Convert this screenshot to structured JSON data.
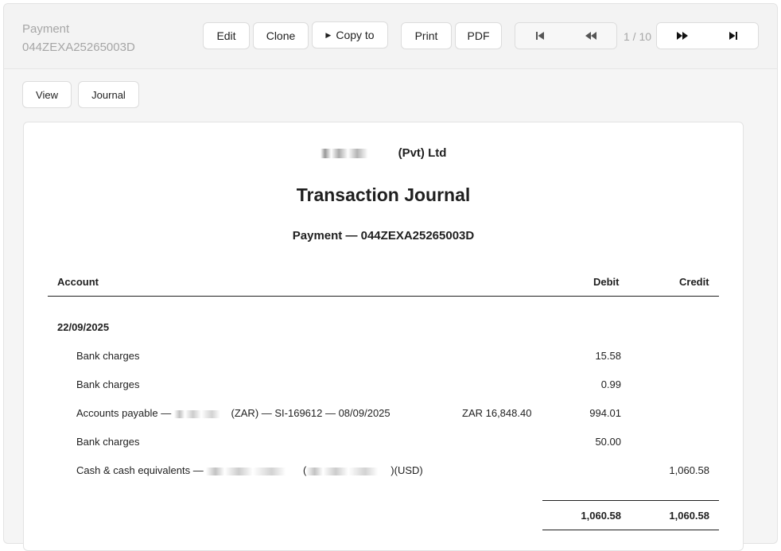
{
  "header": {
    "doc_type": "Payment",
    "doc_number": "044ZEXA25265003D",
    "edit_label": "Edit",
    "clone_label": "Clone",
    "copy_to_label": "Copy to",
    "print_label": "Print",
    "pdf_label": "PDF",
    "pager": "1 / 10"
  },
  "tabs": {
    "view_label": "View",
    "journal_label": "Journal"
  },
  "report": {
    "company_suffix": "(Pvt) Ltd",
    "title": "Transaction Journal",
    "subtitle": "Payment — 044ZEXA25265003D",
    "columns": {
      "account": "Account",
      "debit": "Debit",
      "credit": "Credit"
    },
    "date": "22/09/2025",
    "rows": [
      {
        "account": "Bank charges",
        "debit": "15.58",
        "credit": ""
      },
      {
        "account": "Bank charges",
        "debit": "0.99",
        "credit": ""
      },
      {
        "account_a": "Accounts payable —",
        "account_b": "(ZAR) — SI-169612 — 08/09/2025",
        "foreign": "ZAR 16,848.40",
        "debit": "994.01",
        "credit": ""
      },
      {
        "account": "Bank charges",
        "debit": "50.00",
        "credit": ""
      },
      {
        "account_a": "Cash & cash equivalents —",
        "account_b": "(",
        "account_c": ")(USD)",
        "debit": "",
        "credit": "1,060.58"
      }
    ],
    "totals": {
      "debit": "1,060.58",
      "credit": "1,060.58"
    }
  },
  "colors": {
    "accent_text": "#1f1f1f",
    "muted_text": "#a6a6a6",
    "header_bg": "#f3f3f3"
  },
  "icons": [
    "first-page-icon",
    "previous-page-icon",
    "next-page-icon",
    "last-page-icon",
    "caret-right-icon"
  ]
}
